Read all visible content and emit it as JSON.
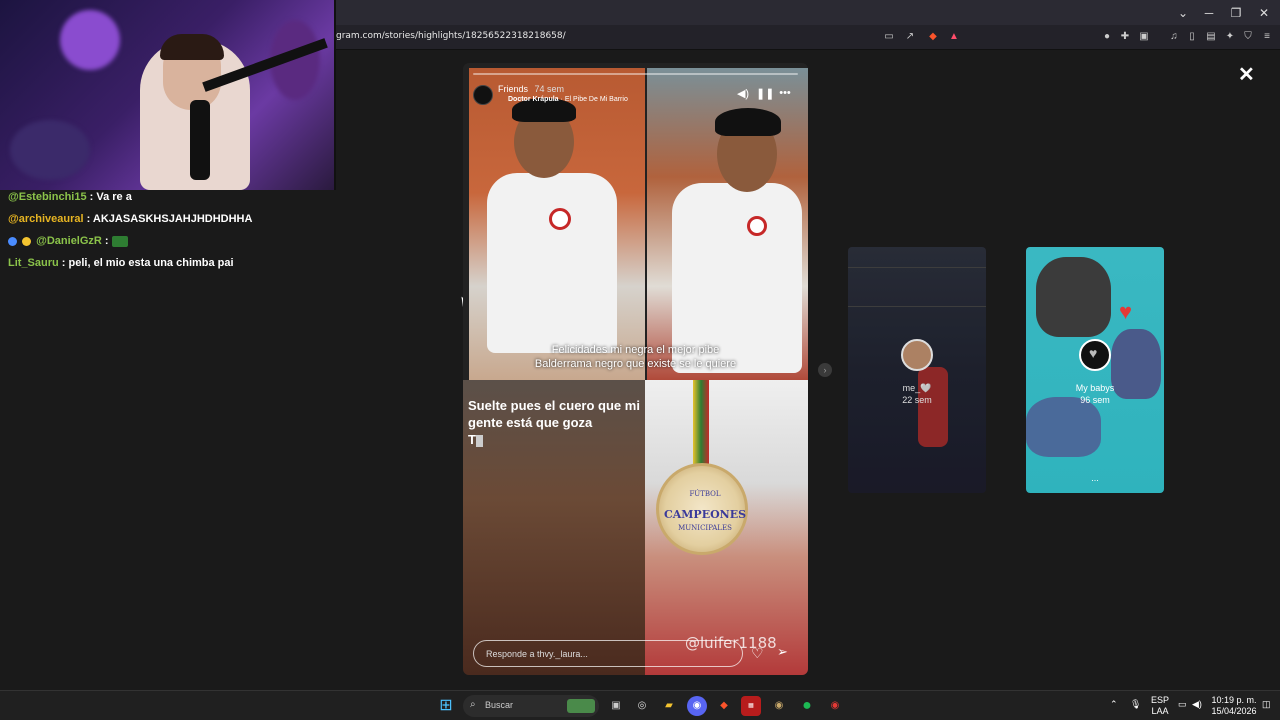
{
  "browser": {
    "url": "gram.com/stories/highlights/18256522318218658/",
    "window_controls": [
      "⌄",
      "─",
      "❐",
      "✕"
    ]
  },
  "chat": {
    "lines": [
      {
        "user": "@Estebinchi15",
        "message": "Va re a",
        "color": "#8bc34a"
      },
      {
        "user": "@archiveaural",
        "message": "AKJASASKHSJAHJHDHDHHA",
        "color": "#e6b422"
      },
      {
        "user": "@DanielGzR",
        "message": "",
        "color": "#8bc34a"
      },
      {
        "user": "Lit_Sauru",
        "message": "peli, el mio esta una chimba pai",
        "color": "#8bc34a"
      }
    ]
  },
  "story": {
    "user": "Friends",
    "time": "74 sem",
    "song_artist": "Doctor Krápula",
    "song_title": "El Pibe De Mi Barrio",
    "progress": 0.0,
    "caption_line1": "Felicidades mi negra  el mejor pibe",
    "caption_line2": "Balderrama negro que existe se le quiere",
    "text_line1": "Suelte pues el cuero que mi",
    "text_line2": "gente está que goza",
    "text_line3": "T",
    "watermark": "@luifer1188",
    "medal_line1": "FÚTBOL",
    "medal_line2": "CAMPEONES",
    "medal_line3": "MUNICIPALES",
    "reply_placeholder": "Responde a thvy._laura..."
  },
  "previews": [
    {
      "name": "me_🤍",
      "time": "22 sem"
    },
    {
      "name": "My babys",
      "time": "96 sem",
      "extra": "..."
    }
  ],
  "taskbar": {
    "search_label": "Buscar",
    "language": "ESP",
    "layout": "LAA",
    "time": "10:19 p. m.",
    "date": "15/04/2026"
  },
  "colors": {
    "accent_green": "#8bc34a",
    "accent_gold": "#e6b422",
    "preview_teal": "#2fb3bd"
  }
}
